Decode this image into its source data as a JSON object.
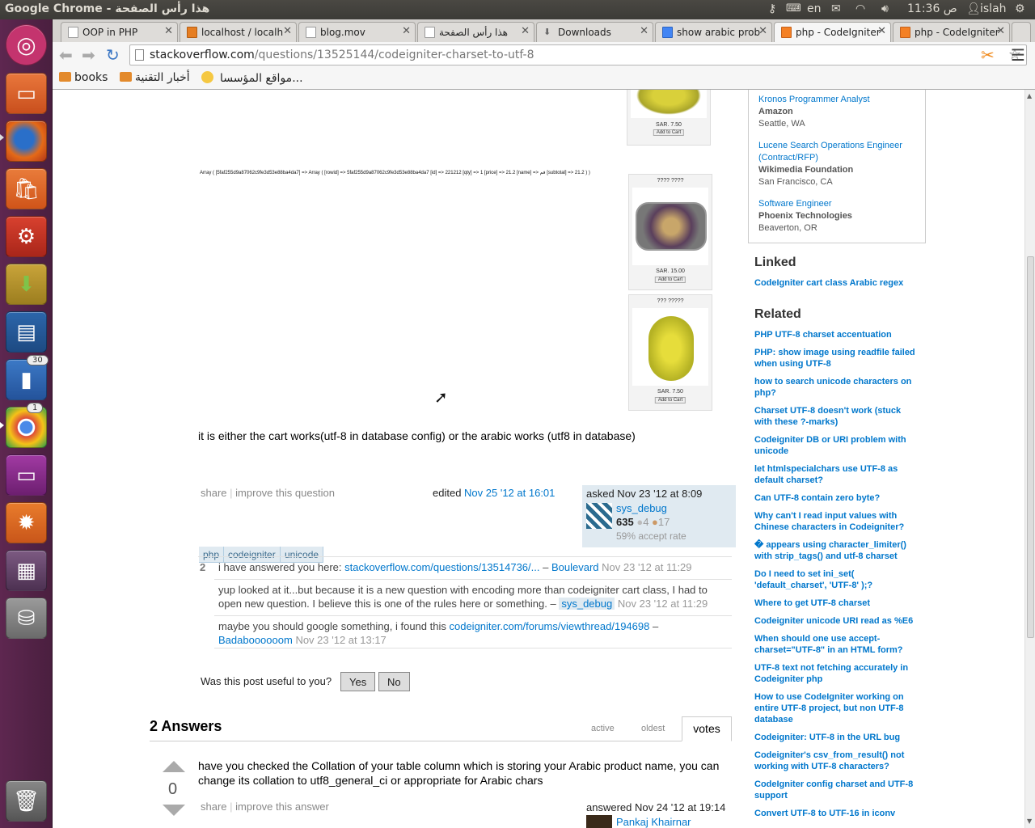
{
  "window": {
    "title": "Google Chrome - هذا رأس الصفحة"
  },
  "panel": {
    "keyboard": "en",
    "time": "11:36 ص",
    "user": "islah"
  },
  "launcher": {
    "badge_counts": [
      "30",
      "1"
    ]
  },
  "tabs": [
    {
      "label": "OOP in PHP"
    },
    {
      "label": "localhost / localh"
    },
    {
      "label": "blog.mov"
    },
    {
      "label": "هذا رأس الصفحة"
    },
    {
      "label": "Downloads"
    },
    {
      "label": "show arabic prob"
    },
    {
      "label": "php - CodeIgniter"
    },
    {
      "label": "php - CodeIgniter"
    }
  ],
  "omnibox": {
    "host": "stackoverflow.com",
    "path": "/questions/13525144/codeigniter-charset-to-utf-8"
  },
  "bookmarks": [
    {
      "label": "books"
    },
    {
      "label": "أخبار التقنية"
    },
    {
      "label": "مواقع المؤسسا..."
    }
  ],
  "products": [
    {
      "title": "",
      "price": "SAR. 7.50",
      "button": "Add to Cart"
    },
    {
      "title": "???? ????",
      "price": "SAR. 15.00",
      "button": "Add to Cart"
    },
    {
      "title": "??? ?????",
      "price": "SAR. 7.50",
      "button": "Add to Cart"
    }
  ],
  "question": {
    "array_dump": "Array ( [5faf255d9a87062c9fe3d53e88ba4da7] => Array ( [rowid] => 5faf255d9a87062c9fe3d53e88ba4da7 [id] => 221212 [qty] => 1 [price] => 21.2 [name] => فم [subtotal] => 21.2 ) )",
    "body": "it is either the cart works(utf-8 in database config) or the arabic works (utf8 in database)",
    "tags": [
      "php",
      "codeigniter",
      "unicode"
    ],
    "share": "share",
    "improve": "improve this question",
    "edited_label": "edited",
    "edited_time": "Nov 25 '12 at 16:01",
    "asked_label": "asked Nov 23 '12 at 8:09",
    "user": {
      "name": "sys_debug",
      "rep": "635",
      "silver": "4",
      "bronze": "17",
      "accept_rate": "59% accept rate"
    }
  },
  "comments": [
    {
      "score": "2",
      "text": "i have answered you here:",
      "link": "stackoverflow.com/questions/13514736/...",
      "dash": "–",
      "user": "Boulevard",
      "time": "Nov 23 '12 at 11:29"
    },
    {
      "score": "",
      "text": "yup looked at it...but because it is a new question with encoding more than codeigniter cart class, I had to open new question. I believe this is one of the rules here or something.",
      "dash": "–",
      "user": "sys_debug",
      "time": "Nov 23 '12 at 11:29"
    },
    {
      "score": "",
      "text": "maybe you should google something, i found this",
      "link": "codeigniter.com/forums/viewthread/194698",
      "dash": "–",
      "user": "Badaboooooom",
      "time": "Nov 23 '12 at 13:17"
    }
  ],
  "useful": {
    "prompt": "Was this post useful to you?",
    "yes": "Yes",
    "no": "No"
  },
  "answers": {
    "heading": "2 Answers",
    "sort_tabs": [
      "active",
      "oldest",
      "votes"
    ],
    "first": {
      "votes": "0",
      "text": "have you checked the Collation of your table column which is storing your Arabic product name, you can change its collation to utf8_general_ci or appropriate for Arabic chars",
      "share": "share",
      "improve": "improve this answer",
      "answered": "answered Nov 24 '12 at 19:14",
      "user": "Pankaj Khairnar"
    }
  },
  "jobs": [
    {
      "title": "Kronos Programmer Analyst",
      "company": "Amazon",
      "location": "Seattle, WA"
    },
    {
      "title": "Lucene Search Operations Engineer (Contract/RFP)",
      "company": "Wikimedia Foundation",
      "location": "San Francisco, CA"
    },
    {
      "title": "Software Engineer",
      "company": "Phoenix Technologies",
      "location": "Beaverton, OR"
    }
  ],
  "linked": {
    "heading": "Linked",
    "items": [
      "CodeIgniter cart class Arabic regex"
    ]
  },
  "related": {
    "heading": "Related",
    "items": [
      "PHP UTF-8 charset accentuation",
      "PHP: show image using readfile failed when using UTF-8",
      "how to search unicode characters on php?",
      "Charset UTF-8 doesn't work (stuck with these ?-marks)",
      "Codeigniter DB or URI problem with unicode",
      "let htmlspecialchars use UTF-8 as default charset?",
      "Can UTF-8 contain zero byte?",
      "Why can't I read input values with Chinese characters in Codeigniter?",
      "� appears using character_limiter() with strip_tags() and utf-8 charset",
      "Do I need to set ini_set( 'default_charset', 'UTF-8' );?",
      "Where to get UTF-8 charset",
      "Codeigniter unicode URI read as %E6",
      "When should one use accept-charset=\"UTF-8\" in an HTML form?",
      "UTF-8 text not fetching accurately in Codeigniter php",
      "How to use CodeIgniter working on entire UTF-8 project, but non UTF-8 database",
      "Codeigniter: UTF-8 in the URL bug",
      "Codeigniter's csv_from_result() not working with UTF-8 characters?",
      "CodeIgniter config charset and UTF-8 support",
      "Convert UTF-8 to UTF-16 in iconv"
    ]
  }
}
